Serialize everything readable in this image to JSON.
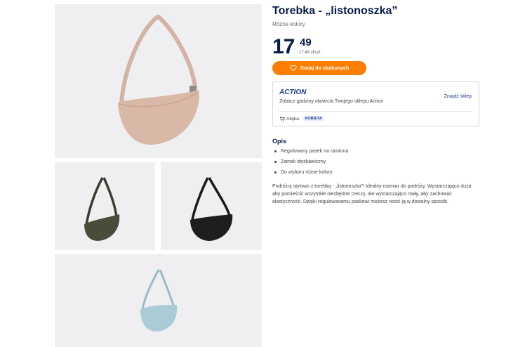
{
  "product": {
    "title": "Torebka - „listonoszka”",
    "subtitle": "Różne kolory",
    "price_integer": "17",
    "price_decimal": "49",
    "price_unit": "17,49 zł/szt.",
    "favorite_label": "Dodaj do ulubionych"
  },
  "store": {
    "logo_text": "ACTION",
    "hours_text": "Zobacz godziny otwarcia Twojego sklepu Action",
    "find_store_label": "Znajdź sklep",
    "aisle_label": "Alejka:",
    "aisle_value": "KOBIETA"
  },
  "description": {
    "heading": "Opis",
    "bullets": [
      "Regulowany pasek na ramiona",
      "Zamek błyskawiczny",
      "Do wyboru różne kolory"
    ],
    "text": "Podróżuj stylowo z torebką - „listonoszka”! Idealny rozmiar do podróży. Wystarczająco duża aby pomieścić wszystkie niezbędne rzeczy, ale wystarczająco mały, aby zachować elastyczność. Dzięki regulowanemu paskowi możesz nosić ją w dowolny sposób."
  },
  "gallery": {
    "images": [
      {
        "name": "bag-pink",
        "color": "#d9b8a8"
      },
      {
        "name": "bag-olive",
        "color": "#4a4b3a"
      },
      {
        "name": "bag-black",
        "color": "#1e1e1e"
      },
      {
        "name": "bag-light-blue",
        "color": "#a9ccd6"
      }
    ]
  },
  "colors": {
    "brand_navy": "#071d49",
    "accent_orange": "#ff7d00",
    "link_blue": "#1e3c8c"
  }
}
